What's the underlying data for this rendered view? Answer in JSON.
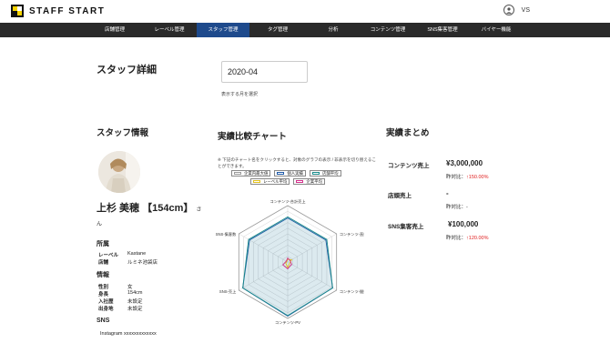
{
  "app": {
    "logo_text": "STAFF START",
    "user_label": "VS"
  },
  "nav": [
    {
      "label": "店舗管理",
      "active": false
    },
    {
      "label": "レーベル管理",
      "active": false
    },
    {
      "label": "スタッフ管理",
      "active": true
    },
    {
      "label": "タグ管理",
      "active": false
    },
    {
      "label": "分析",
      "active": false
    },
    {
      "label": "コンテンツ管理",
      "active": false
    },
    {
      "label": "SNS集客管理",
      "active": false
    },
    {
      "label": "バイヤー機能",
      "active": false
    }
  ],
  "page": {
    "title": "スタッフ詳細",
    "month_value": "2020-04",
    "month_hint": "表示する月を選択"
  },
  "staff": {
    "section_title": "スタッフ情報",
    "name": "上杉 美穂 【154cm】",
    "name_suffix_a": "さ",
    "name_suffix_b": "ん",
    "affiliation_title": "所属",
    "label_key": "レーベル",
    "label_value": "Kastane",
    "shop_key": "店舗",
    "shop_value": "ルミネ池袋店",
    "info_title": "情報",
    "gender_key": "性別",
    "gender_value": "女",
    "height_key": "身長",
    "height_value": "154cm",
    "joined_key": "入社歴",
    "joined_value": "未設定",
    "origin_key": "出身地",
    "origin_value": "未設定",
    "sns_title": "SNS",
    "sns_value": "Instagram xxxxxxxxxxxxx"
  },
  "chart": {
    "section_title": "実績比較チャート",
    "note": "※ 下記のチャート名をクリックすると、対象のグラフの表示 / 非表示を切り替えることができます。",
    "legend": [
      {
        "label": "企業内最大値",
        "color": "#9a9a9a"
      },
      {
        "label": "個人実績",
        "color": "#1e5aa8"
      },
      {
        "label": "店舗平均",
        "color": "#1a8a8a"
      },
      {
        "label": "レーベル平均",
        "color": "#e0c020"
      },
      {
        "label": "企業平均",
        "color": "#d0308a"
      }
    ]
  },
  "chart_data": {
    "type": "radar",
    "axes": [
      "コンテンツ-合計売上",
      "コンテンツ-直接売上",
      "コンテンツ-間接売上",
      "コンテンツ-PV",
      "SNS-売上",
      "SNS-集客数"
    ],
    "rmax": 1.0,
    "grid_levels": 10,
    "series": [
      {
        "name": "企業内最大値",
        "values": [
          1.0,
          1.0,
          1.0,
          1.0,
          1.0,
          1.0
        ],
        "color": "#9a9a9a"
      },
      {
        "name": "個人実績",
        "values": [
          0.78,
          0.78,
          0.92,
          0.96,
          0.92,
          0.78
        ],
        "color": "#1e5aa8"
      },
      {
        "name": "店舗平均",
        "values": [
          0.8,
          0.8,
          0.92,
          0.95,
          0.92,
          0.8
        ],
        "color": "#1a8a8a"
      },
      {
        "name": "レーベル平均",
        "values": [
          0.05,
          0.08,
          0.04,
          0.1,
          0.04,
          0.02
        ],
        "color": "#e0c020"
      },
      {
        "name": "企業平均",
        "values": [
          0.07,
          0.05,
          0.08,
          0.12,
          0.1,
          0.03
        ],
        "color": "#d0308a"
      }
    ]
  },
  "summary": {
    "section_title": "実績まとめ",
    "content_label": "コンテンツ売上",
    "content_value": "¥3,000,000",
    "content_yoy_prefix": "昨対比：",
    "content_yoy": "↑150.00%",
    "shop_label": "店頭売上",
    "shop_value": "-",
    "shop_yoy": "昨対比：-",
    "sns_label": "SNS集客売上",
    "sns_value": "¥100,000",
    "sns_yoy_prefix": "昨対比：",
    "sns_yoy": "↑120.00%"
  }
}
